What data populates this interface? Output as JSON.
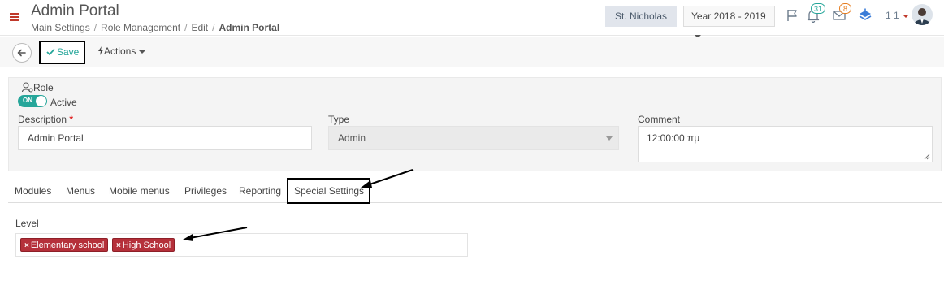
{
  "header": {
    "title": "Admin Portal",
    "breadcrumb": [
      "Main Settings",
      "Role Management",
      "Edit"
    ],
    "breadcrumb_current": "Admin Portal",
    "school": "St. Nicholas",
    "year": "Year 2018 - 2019",
    "notifications_count": "31",
    "messages_count": "8",
    "user_label": "1 1",
    "icons": [
      "menu-icon",
      "flag-icon",
      "bell-icon",
      "envelope-icon",
      "layers-icon",
      "avatar"
    ]
  },
  "toolbar": {
    "save_label": "Save",
    "actions_label": "Actions"
  },
  "form": {
    "section_title": "Role",
    "toggle_text": "ON",
    "active_label": "Active",
    "description_label": "Description",
    "description_required_mark": "*",
    "description_value": "Admin Portal",
    "type_label": "Type",
    "type_value": "Admin",
    "comment_label": "Comment",
    "comment_value": "12:00:00 πμ"
  },
  "tabs": [
    {
      "label": "Modules"
    },
    {
      "label": "Menus"
    },
    {
      "label": "Mobile menus"
    },
    {
      "label": "Privileges"
    },
    {
      "label": "Reporting"
    },
    {
      "label": "Special Settings"
    }
  ],
  "level": {
    "label": "Level",
    "tags": [
      "Elementary school",
      "High School"
    ]
  },
  "colors": {
    "accent_green": "#26a69a",
    "tag_red": "#b5303a",
    "menu_red": "#c0392b",
    "badge_green": "#26a69a",
    "badge_orange": "#e67e22"
  }
}
